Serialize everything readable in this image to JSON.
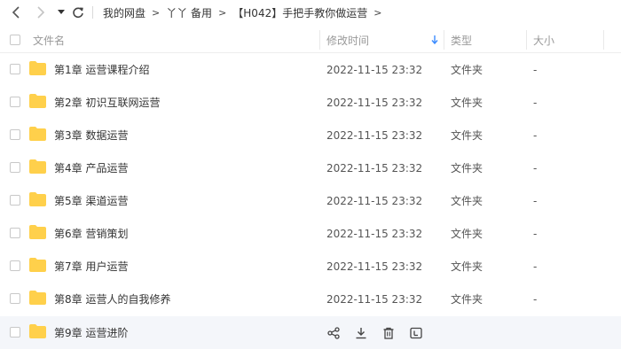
{
  "toolbar": {
    "back_icon": "chevron-left-icon",
    "forward_icon": "chevron-right-icon",
    "history_icon": "caret-down-icon",
    "refresh_icon": "refresh-icon"
  },
  "breadcrumb": {
    "items": [
      "我的网盘",
      "丫丫 备用",
      "【H042】手把手教你做运营"
    ],
    "separator": ">"
  },
  "header": {
    "name": "文件名",
    "modified": "修改时间",
    "type": "类型",
    "size": "大小",
    "sort_icon": "sort-down-arrow-icon",
    "sort_color": "#3b8cff"
  },
  "files": [
    {
      "name": "第1章 运营课程介绍",
      "date": "2022-11-15 23:32",
      "type": "文件夹",
      "size": "-"
    },
    {
      "name": "第2章 初识互联网运营",
      "date": "2022-11-15 23:32",
      "type": "文件夹",
      "size": "-"
    },
    {
      "name": "第3章 数据运营",
      "date": "2022-11-15 23:32",
      "type": "文件夹",
      "size": "-"
    },
    {
      "name": "第4章 产品运营",
      "date": "2022-11-15 23:32",
      "type": "文件夹",
      "size": "-"
    },
    {
      "name": "第5章 渠道运营",
      "date": "2022-11-15 23:32",
      "type": "文件夹",
      "size": "-"
    },
    {
      "name": "第6章 营销策划",
      "date": "2022-11-15 23:32",
      "type": "文件夹",
      "size": "-"
    },
    {
      "name": "第7章 用户运营",
      "date": "2022-11-15 23:32",
      "type": "文件夹",
      "size": "-"
    },
    {
      "name": "第8章 运营人的自我修养",
      "date": "2022-11-15 23:32",
      "type": "文件夹",
      "size": "-"
    },
    {
      "name": "第9章 运营进阶",
      "hovered": true,
      "actions": [
        "share-icon",
        "download-icon",
        "delete-icon",
        "more-icon"
      ]
    }
  ],
  "colors": {
    "folder": "#ffd04b",
    "hover_row": "#f4f6fa",
    "header_text": "#999999"
  }
}
